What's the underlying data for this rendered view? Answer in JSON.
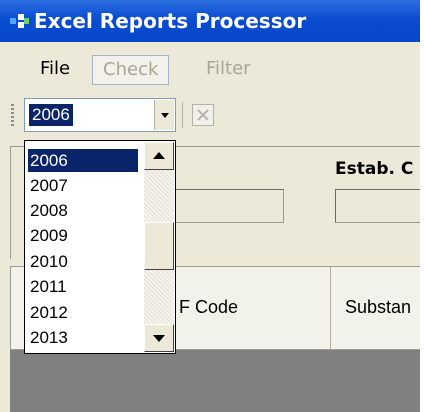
{
  "window": {
    "title": "Excel Reports Processor",
    "app_icon": "excel-grid-icon"
  },
  "menu": {
    "file": "File",
    "check": "Check",
    "filter": "Filter"
  },
  "toolbar": {
    "year_value": "2006",
    "clear_icon": "clear-filter-icon"
  },
  "form": {
    "estab_label": "Estab. C"
  },
  "grid": {
    "col_fcode": "F Code",
    "col_substance": "Substan"
  },
  "dropdown": {
    "options": [
      "2006",
      "2007",
      "2008",
      "2009",
      "2010",
      "2011",
      "2012",
      "2013"
    ],
    "selected": "2006"
  },
  "colors": {
    "titlebar": "#0a4bd1",
    "selection": "#0a246a",
    "chrome": "#ece9d8",
    "grid_body": "#808080"
  }
}
